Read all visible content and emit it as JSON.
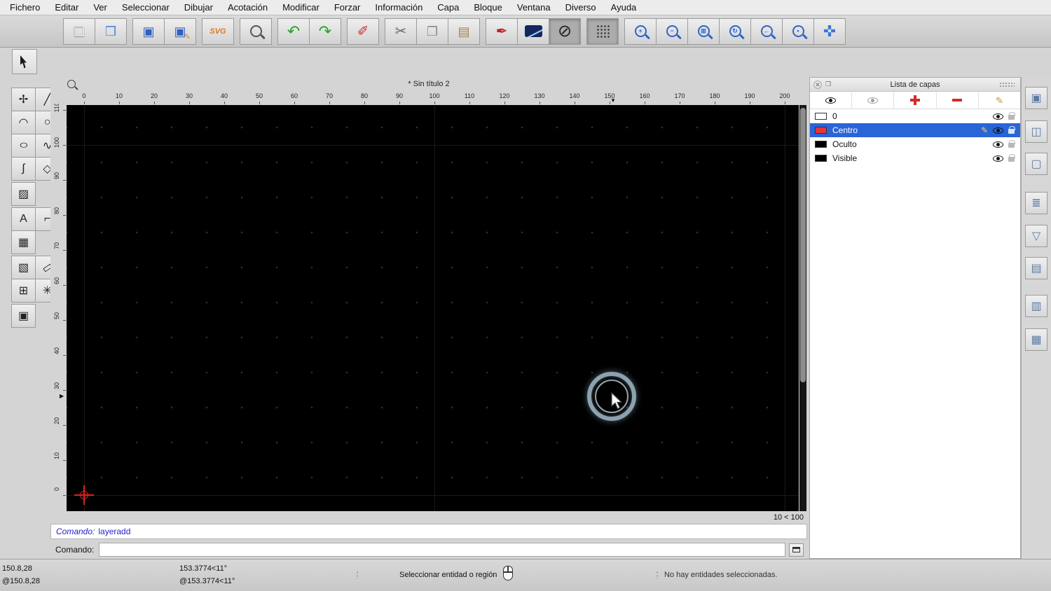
{
  "menu": {
    "items": [
      "Fichero",
      "Editar",
      "Ver",
      "Seleccionar",
      "Dibujar",
      "Acotación",
      "Modificar",
      "Forzar",
      "Información",
      "Capa",
      "Bloque",
      "Ventana",
      "Diverso",
      "Ayuda"
    ]
  },
  "toolbar": {
    "groups": [
      [
        {
          "name": "new-file",
          "kind": "glyph",
          "glyph": "❏",
          "color": "#f6f3e2",
          "shadow": true
        },
        {
          "name": "open-file",
          "kind": "glyph",
          "glyph": "❒",
          "color": "#4a86d8"
        }
      ],
      [
        {
          "name": "save",
          "kind": "glyph",
          "glyph": "▣",
          "color": "#2f5fc0"
        },
        {
          "name": "save-as",
          "kind": "stack",
          "glyph": "▣",
          "color": "#2f5fc0",
          "glyph2": "✎",
          "color2": "#d8921e"
        }
      ],
      [
        {
          "name": "svg-export",
          "kind": "text",
          "glyph": "SVG",
          "color": "#e07818"
        }
      ],
      [
        {
          "name": "print-preview",
          "kind": "mag",
          "glyph": "",
          "color": "#555555"
        }
      ],
      [
        {
          "name": "undo",
          "kind": "glyph",
          "glyph": "↶",
          "color": "#2da02d",
          "size": 22
        },
        {
          "name": "redo",
          "kind": "glyph",
          "glyph": "↷",
          "color": "#2da02d",
          "size": 22
        }
      ],
      [
        {
          "name": "delete",
          "kind": "glyph",
          "glyph": "✐",
          "color": "#d03030",
          "size": 20
        }
      ],
      [
        {
          "name": "cut",
          "kind": "glyph",
          "glyph": "✂",
          "color": "#666666",
          "size": 20
        },
        {
          "name": "copy",
          "kind": "glyph",
          "glyph": "❐",
          "color": "#8a8a8a",
          "size": 18
        },
        {
          "name": "paste",
          "kind": "glyph",
          "glyph": "▤",
          "color": "#a8834a",
          "size": 18
        }
      ],
      [
        {
          "name": "pen-attributes",
          "kind": "glyph",
          "glyph": "✒",
          "color": "#c02020",
          "size": 20
        },
        {
          "name": "line-attributes",
          "kind": "lineattr"
        },
        {
          "name": "no-fill",
          "kind": "glyph",
          "glyph": "⊘",
          "color": "#222222",
          "size": 24,
          "pressed": true
        }
      ],
      [
        {
          "name": "grid-toggle",
          "kind": "grid",
          "pressed": true
        }
      ],
      [
        {
          "name": "zoom-in",
          "kind": "mag",
          "glyph": "+",
          "color": "#2f64c8"
        },
        {
          "name": "zoom-out",
          "kind": "mag",
          "glyph": "−",
          "color": "#2f64c8"
        },
        {
          "name": "zoom-auto",
          "kind": "mag",
          "glyph": "⊞",
          "color": "#2f64c8"
        },
        {
          "name": "zoom-redraw",
          "kind": "mag",
          "glyph": "↻",
          "color": "#2f64c8"
        },
        {
          "name": "zoom-previous",
          "kind": "mag",
          "glyph": "←",
          "color": "#2f64c8"
        },
        {
          "name": "zoom-window",
          "kind": "mag",
          "glyph": "▪",
          "color": "#2f64c8"
        },
        {
          "name": "pan",
          "kind": "glyph",
          "glyph": "✜",
          "color": "#3b78d8",
          "size": 22
        }
      ]
    ]
  },
  "palette": {
    "rows": [
      [
        {
          "name": "points",
          "glyph": "✢"
        },
        {
          "name": "line",
          "glyph": "╱"
        }
      ],
      [
        {
          "name": "arc",
          "glyph": "◠"
        },
        {
          "name": "circle",
          "glyph": "○"
        }
      ],
      [
        {
          "name": "ellipse",
          "glyph": "○",
          "cls": "stretch"
        },
        {
          "name": "spline",
          "glyph": "∿"
        }
      ],
      [
        {
          "name": "freehand",
          "glyph": "∫"
        },
        {
          "name": "polygon",
          "glyph": "◇"
        }
      ],
      [
        {
          "name": "hatch",
          "glyph": "▨"
        }
      ],
      [
        {
          "name": "text",
          "glyph": "A"
        },
        {
          "name": "dimension",
          "glyph": "⌐"
        }
      ],
      [
        {
          "name": "image",
          "glyph": "▦"
        }
      ],
      [
        {
          "name": "pattern",
          "glyph": "▧"
        },
        {
          "name": "measure",
          "glyph": "▭",
          "cls": "tilt"
        }
      ],
      [
        {
          "name": "modify",
          "glyph": "⊞"
        },
        {
          "name": "explode",
          "glyph": "✳"
        }
      ],
      [
        {
          "name": "isometric",
          "glyph": "▣"
        }
      ]
    ]
  },
  "canvas": {
    "title": "* Sin título 2",
    "grid_status": "10 < 100",
    "hruler": [
      "0",
      "10",
      "20",
      "30",
      "40",
      "50",
      "60",
      "70",
      "80",
      "90",
      "100",
      "110",
      "120",
      "130",
      "140",
      "150",
      "160",
      "170",
      "180",
      "190",
      "200"
    ],
    "vruler": [
      "110",
      "100",
      "90",
      "80",
      "70",
      "60",
      "50",
      "40",
      "30",
      "20",
      "10",
      "0"
    ]
  },
  "layers_panel": {
    "title": "Lista de capas",
    "layers": [
      {
        "name": "0",
        "color": "#ffffff",
        "selected": false
      },
      {
        "name": "Centro",
        "color": "#e8323c",
        "selected": true
      },
      {
        "name": "Oculto",
        "color": "#000000",
        "selected": false
      },
      {
        "name": "Visible",
        "color": "#000000",
        "selected": false
      }
    ]
  },
  "command": {
    "history_label": "Comando:",
    "history_value": "layeradd",
    "input_label": "Comando:",
    "input_value": ""
  },
  "statusbar": {
    "coord_abs": "150.8,28",
    "coord_rel": "@150.8,28",
    "polar_abs": "153.3774<11°",
    "polar_rel": "@153.3774<11°",
    "hint": "Seleccionar entidad o región",
    "selection": "No hay entidades seleccionadas."
  },
  "dock": {
    "icons": [
      {
        "name": "block-list",
        "glyph": "▣"
      },
      {
        "name": "library-browser",
        "glyph": "◫"
      },
      {
        "name": "page",
        "glyph": "▢"
      },
      {
        "name": "layer-list",
        "glyph": "≣"
      },
      {
        "name": "filter",
        "glyph": "▽"
      },
      {
        "name": "properties",
        "glyph": "▤"
      },
      {
        "name": "command-dock",
        "glyph": "▥"
      },
      {
        "name": "clipboard",
        "glyph": "▦"
      }
    ]
  }
}
